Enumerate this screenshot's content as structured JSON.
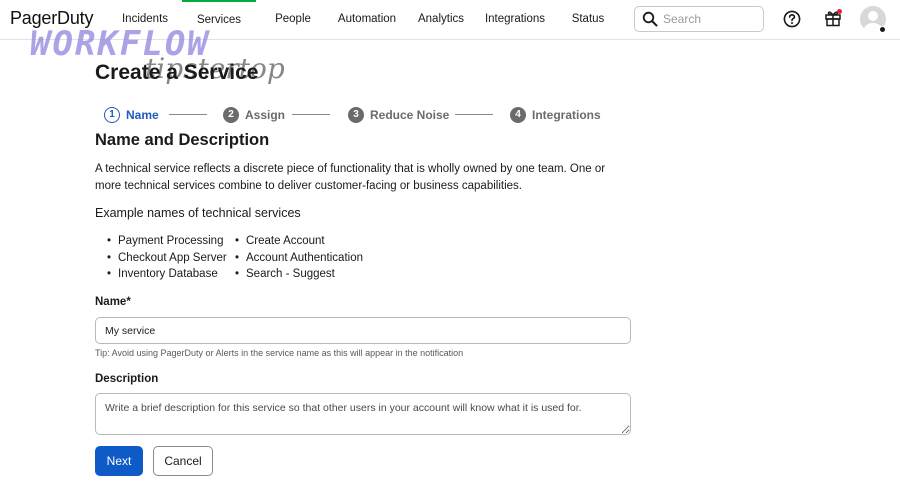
{
  "app": {
    "logo": "PagerDuty"
  },
  "nav": {
    "items": [
      "Incidents",
      "Services",
      "People",
      "Automation",
      "Analytics",
      "Integrations",
      "Status"
    ],
    "active": "Services"
  },
  "search": {
    "placeholder": "Search",
    "value": ""
  },
  "icons": {
    "search": "search-icon",
    "help": "help-icon",
    "gift": "gift-icon",
    "avatar": "avatar"
  },
  "watermark": {
    "line1": "WORKFLOW",
    "line2": "tipstertop"
  },
  "page": {
    "title": "Create a Service"
  },
  "steps": [
    {
      "num": "1",
      "label": "Name",
      "active": true
    },
    {
      "num": "2",
      "label": "Assign",
      "active": false
    },
    {
      "num": "3",
      "label": "Reduce Noise",
      "active": false
    },
    {
      "num": "4",
      "label": "Integrations",
      "active": false
    }
  ],
  "section": {
    "title": "Name and Description",
    "intro": "A technical service reflects a discrete piece of functionality that is wholly owned by one team. One or more technical services combine to deliver customer-facing or business capabilities.",
    "examples_title": "Example names of technical services",
    "examples_col1": [
      "Payment Processing",
      "Checkout App Server",
      "Inventory Database"
    ],
    "examples_col2": [
      "Create Account",
      "Account Authentication",
      "Search - Suggest"
    ]
  },
  "form": {
    "name_label": "Name*",
    "name_value": "My service",
    "name_tip": "Tip: Avoid using PagerDuty or Alerts in the service name as this will appear in the notification",
    "description_label": "Description",
    "description_placeholder": "Write a brief description for this service so that other users in your account will know what it is used for.",
    "description_value": ""
  },
  "buttons": {
    "next": "Next",
    "cancel": "Cancel"
  },
  "colors": {
    "primary": "#0e5bc7",
    "active_step": "#1f5bbd",
    "nav_active_border": "#06ac38",
    "notification_dot": "#e0253a"
  }
}
